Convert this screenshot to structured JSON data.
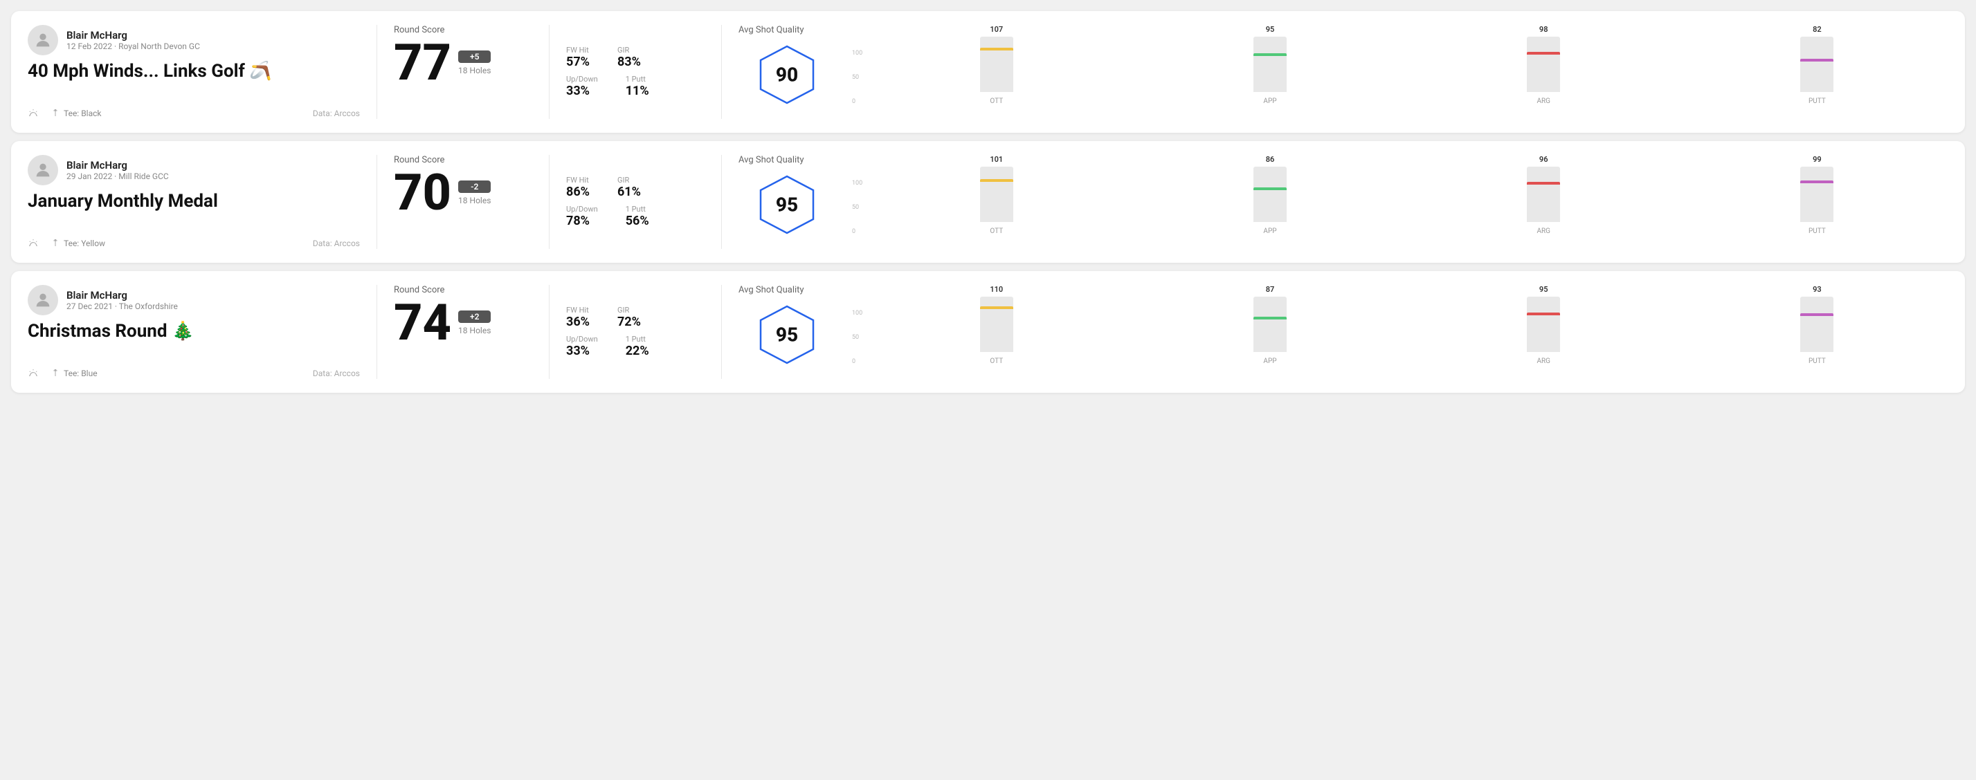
{
  "rounds": [
    {
      "player_name": "Blair McHarg",
      "player_meta": "12 Feb 2022 · Royal North Devon GC",
      "round_title": "40 Mph Winds... Links Golf 🪃",
      "tee": "Tee: Black",
      "data_source": "Data: Arccos",
      "score_label": "Round Score",
      "score_number": "77",
      "score_badge": "+5",
      "score_holes": "18 Holes",
      "fw_hit_label": "FW Hit",
      "fw_hit_value": "57%",
      "gir_label": "GIR",
      "gir_value": "83%",
      "updown_label": "Up/Down",
      "updown_value": "33%",
      "oneputt_label": "1 Putt",
      "oneputt_value": "11%",
      "quality_label": "Avg Shot Quality",
      "quality_score": "90",
      "chart": {
        "bars": [
          {
            "label": "OTT",
            "value": 107,
            "color": "#f0c040",
            "pct": 75
          },
          {
            "label": "APP",
            "value": 95,
            "color": "#50c878",
            "pct": 65
          },
          {
            "label": "ARG",
            "value": 98,
            "color": "#e05050",
            "pct": 68
          },
          {
            "label": "PUTT",
            "value": 82,
            "color": "#c060c0",
            "pct": 55
          }
        ],
        "y_max": "100",
        "y_mid": "50",
        "y_min": "0"
      }
    },
    {
      "player_name": "Blair McHarg",
      "player_meta": "29 Jan 2022 · Mill Ride GCC",
      "round_title": "January Monthly Medal",
      "tee": "Tee: Yellow",
      "data_source": "Data: Arccos",
      "score_label": "Round Score",
      "score_number": "70",
      "score_badge": "-2",
      "score_holes": "18 Holes",
      "fw_hit_label": "FW Hit",
      "fw_hit_value": "86%",
      "gir_label": "GIR",
      "gir_value": "61%",
      "updown_label": "Up/Down",
      "updown_value": "78%",
      "oneputt_label": "1 Putt",
      "oneputt_value": "56%",
      "quality_label": "Avg Shot Quality",
      "quality_score": "95",
      "chart": {
        "bars": [
          {
            "label": "OTT",
            "value": 101,
            "color": "#f0c040",
            "pct": 72
          },
          {
            "label": "APP",
            "value": 86,
            "color": "#50c878",
            "pct": 58
          },
          {
            "label": "ARG",
            "value": 96,
            "color": "#e05050",
            "pct": 67
          },
          {
            "label": "PUTT",
            "value": 99,
            "color": "#c060c0",
            "pct": 70
          }
        ],
        "y_max": "100",
        "y_mid": "50",
        "y_min": "0"
      }
    },
    {
      "player_name": "Blair McHarg",
      "player_meta": "27 Dec 2021 · The Oxfordshire",
      "round_title": "Christmas Round 🎄",
      "tee": "Tee: Blue",
      "data_source": "Data: Arccos",
      "score_label": "Round Score",
      "score_number": "74",
      "score_badge": "+2",
      "score_holes": "18 Holes",
      "fw_hit_label": "FW Hit",
      "fw_hit_value": "36%",
      "gir_label": "GIR",
      "gir_value": "72%",
      "updown_label": "Up/Down",
      "updown_value": "33%",
      "oneputt_label": "1 Putt",
      "oneputt_value": "22%",
      "quality_label": "Avg Shot Quality",
      "quality_score": "95",
      "chart": {
        "bars": [
          {
            "label": "OTT",
            "value": 110,
            "color": "#f0c040",
            "pct": 78
          },
          {
            "label": "APP",
            "value": 87,
            "color": "#50c878",
            "pct": 59
          },
          {
            "label": "ARG",
            "value": 95,
            "color": "#e05050",
            "pct": 66
          },
          {
            "label": "PUTT",
            "value": 93,
            "color": "#c060c0",
            "pct": 65
          }
        ],
        "y_max": "100",
        "y_mid": "50",
        "y_min": "0"
      }
    }
  ]
}
